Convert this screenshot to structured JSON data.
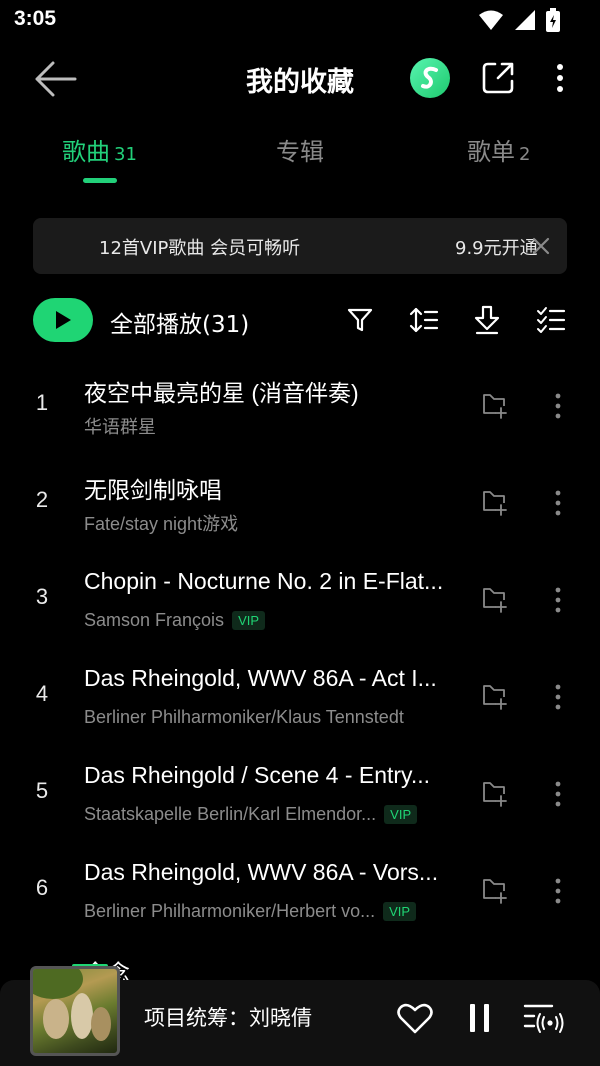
{
  "status_bar": {
    "time": "3:05"
  },
  "header": {
    "title": "我的收藏"
  },
  "tabs": [
    {
      "label": "歌曲",
      "count": "31"
    },
    {
      "label": "专辑",
      "count": ""
    },
    {
      "label": "歌单",
      "count": "2"
    }
  ],
  "vip_banner": {
    "text": "12首VIP歌曲 会员可畅听",
    "action": "9.9元开通"
  },
  "play_all": {
    "label": "全部播放(31)"
  },
  "songs": [
    {
      "index": "1",
      "title": "夜空中最亮的星 (消音伴奏)",
      "artist": "华语群星",
      "vip": ""
    },
    {
      "index": "2",
      "title": "无限剑制咏唱",
      "artist": "Fate/stay night游戏",
      "vip": ""
    },
    {
      "index": "3",
      "title": "Chopin - Nocturne No. 2 in E-Flat...",
      "artist": "Samson François",
      "vip": "VIP"
    },
    {
      "index": "4",
      "title": "Das Rheingold, WWV 86A - Act I...",
      "artist": "Berliner Philharmoniker/Klaus Tennstedt",
      "vip": ""
    },
    {
      "index": "5",
      "title": "Das Rheingold / Scene 4 - Entry...",
      "artist": "Staatskapelle Berlin/Karl Elmendor...",
      "vip": "VIP"
    },
    {
      "index": "6",
      "title": "Das Rheingold, WWV 86A - Vors...",
      "artist": "Berliner Philharmoniker/Herbert vo...",
      "vip": "VIP"
    }
  ],
  "peek_song": {
    "title": "念念"
  },
  "mini_player": {
    "title": "项目统筹：刘晓倩"
  },
  "colors": {
    "accent": "#1fd574",
    "background": "#000000",
    "banner": "#1b1b1b"
  }
}
